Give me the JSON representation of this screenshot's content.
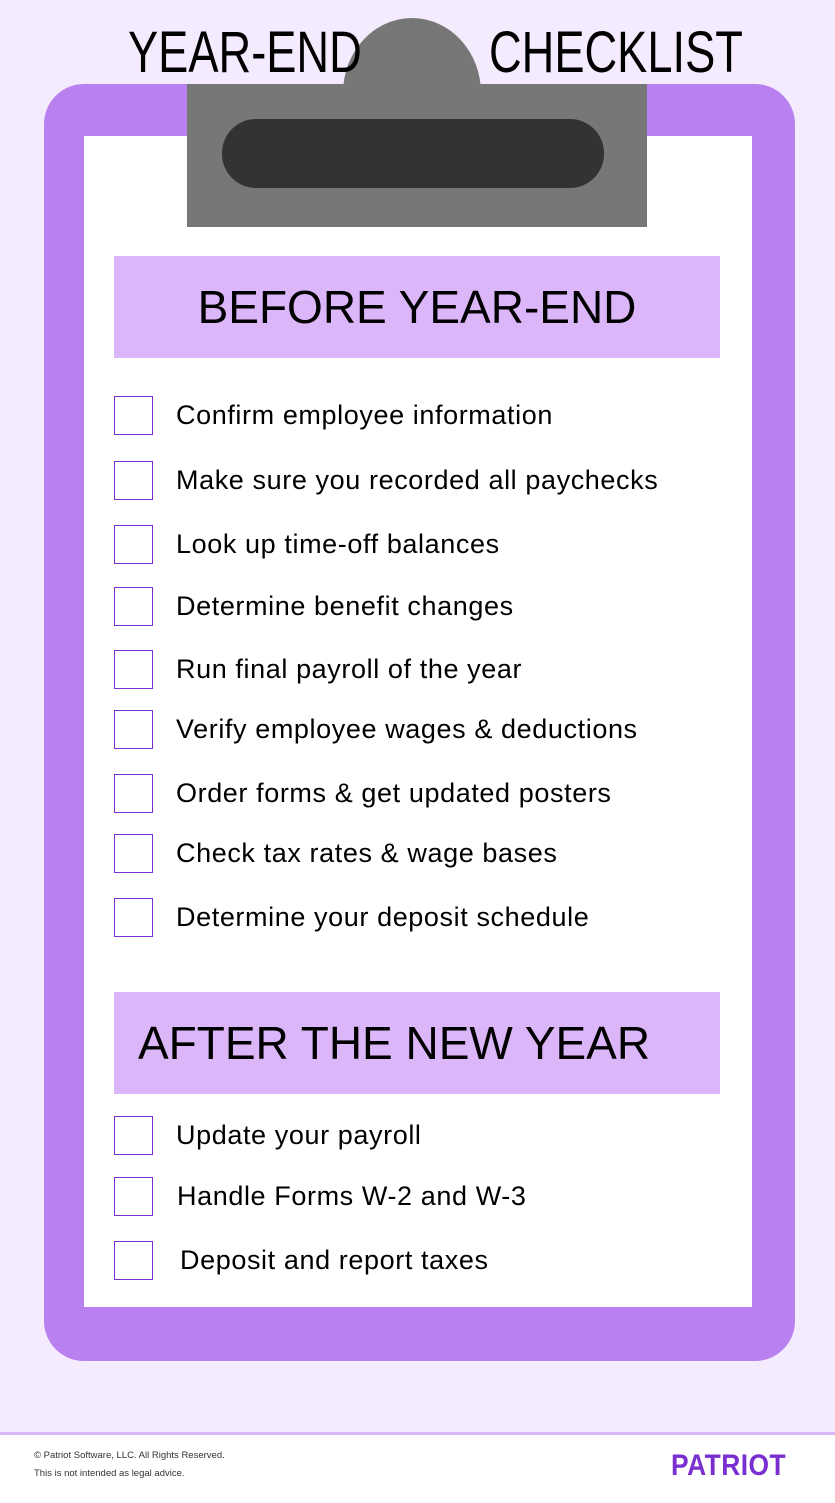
{
  "header": {
    "title_left": "YEAR-END",
    "title_right": "CHECKLIST"
  },
  "colors": {
    "background": "#f5ebfe",
    "board": "#b980f0",
    "section_bg": "#dbb6f9",
    "clip": "#777777",
    "clip_slot": "#333333",
    "checkbox_border": "#7a2fd0",
    "brand": "#7a2fd0"
  },
  "sections": [
    {
      "heading": "BEFORE YEAR-END",
      "items": [
        {
          "label": "Confirm employee information",
          "checked": false
        },
        {
          "label": "Make sure you recorded all paychecks",
          "checked": false
        },
        {
          "label": "Look up time-off balances",
          "checked": false
        },
        {
          "label": "Determine benefit changes",
          "checked": false
        },
        {
          "label": "Run final payroll of the year",
          "checked": false
        },
        {
          "label": "Verify employee wages & deductions",
          "checked": false
        },
        {
          "label": "Order forms & get updated posters",
          "checked": false
        },
        {
          "label": "Check tax rates & wage bases",
          "checked": false
        },
        {
          "label": "Determine your deposit schedule",
          "checked": false
        }
      ]
    },
    {
      "heading": "AFTER THE NEW YEAR",
      "items": [
        {
          "label": "Update your payroll",
          "checked": false
        },
        {
          "label": "Handle Forms W-2 and W-3",
          "checked": false
        },
        {
          "label": "Deposit and report taxes",
          "checked": false
        }
      ]
    }
  ],
  "footer": {
    "copyright": "© Patriot Software, LLC. All Rights Reserved.",
    "disclaimer": "This is not intended as legal advice.",
    "logo": "PATRIOT"
  }
}
